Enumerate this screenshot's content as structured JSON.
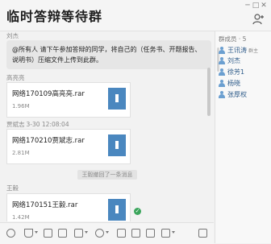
{
  "window": {
    "title": "临时答辩等待群",
    "controls": [
      "─",
      "□",
      "✕"
    ]
  },
  "chat": {
    "messages": [
      {
        "sender": "刘杰",
        "text": "@所有人 请下午参加答辩的同学，将自己的（任务书、开题报告、说明书）压缩文件上传到此群。"
      },
      {
        "sender": "高亮亮",
        "file_name": "网络170109高亮亮.rar",
        "file_size": "1.96M"
      },
      {
        "sender": "贾斌志",
        "time": "3-30 12:08:04",
        "file_name": "网络170210贾斌志.rar",
        "file_size": "2.81M"
      },
      {
        "system": "王毅撤回了一条消息"
      },
      {
        "sender": "王毅",
        "file_name": "网络170151王毅.rar",
        "file_size": "1.42M"
      }
    ]
  },
  "members": {
    "title": "群成员 · 5",
    "list": [
      {
        "name": "王讯涛",
        "tag": "群主"
      },
      {
        "name": "刘杰"
      },
      {
        "name": "徐芳1"
      },
      {
        "name": "杨晓"
      },
      {
        "name": "张厚权"
      }
    ]
  },
  "colors": {
    "accent": "#4a87bf",
    "status_ok": "#3ba55c"
  },
  "icons": [
    "add-member-icon",
    "emoji-icon",
    "cut-icon",
    "image-icon",
    "folder-icon",
    "screenshot-icon",
    "voice-icon",
    "more-icon",
    "history-icon",
    "file-archive-icon",
    "check-icon",
    "person-icon"
  ]
}
